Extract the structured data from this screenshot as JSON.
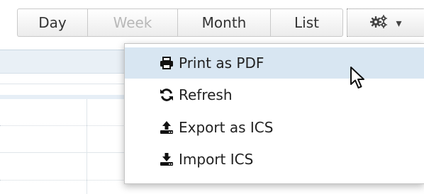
{
  "toolbar": {
    "views": [
      {
        "label": "Day",
        "state": "normal"
      },
      {
        "label": "Week",
        "state": "disabled"
      },
      {
        "label": "Month",
        "state": "normal"
      },
      {
        "label": "List",
        "state": "normal"
      }
    ],
    "settings": {
      "icon": "gears-icon",
      "caret": "▾"
    }
  },
  "menu": {
    "items": [
      {
        "label": "Print as PDF",
        "icon": "printer-icon",
        "hovered": true
      },
      {
        "label": "Refresh",
        "icon": "refresh-icon",
        "hovered": false
      },
      {
        "label": "Export as ICS",
        "icon": "upload-icon",
        "hovered": false
      },
      {
        "label": "Import ICS",
        "icon": "download-icon",
        "hovered": false
      }
    ]
  },
  "colors": {
    "menu_hover": "#d8e6f2",
    "calendar_band": "#e9f0f6",
    "disabled_text": "#b8b8b8"
  }
}
